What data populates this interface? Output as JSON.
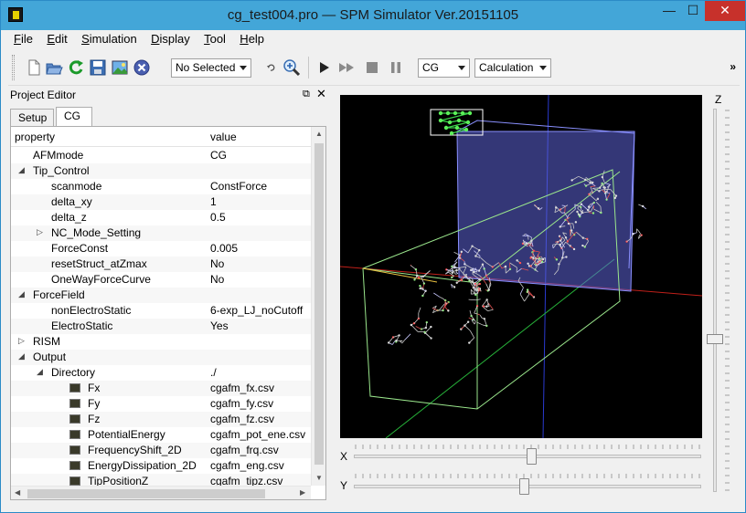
{
  "window": {
    "title": "cg_test004.pro — SPM Simulator Ver.20151105",
    "minimize": "—",
    "maximize": "☐",
    "close": "✕"
  },
  "menu": {
    "items": [
      {
        "key": "F",
        "rest": "ile"
      },
      {
        "key": "E",
        "rest": "dit"
      },
      {
        "key": "S",
        "rest": "imulation"
      },
      {
        "key": "D",
        "rest": "isplay"
      },
      {
        "key": "T",
        "rest": "ool"
      },
      {
        "key": "H",
        "rest": "elp"
      }
    ]
  },
  "toolbar": {
    "selection_combo": "No Selected",
    "mode_combo": "CG",
    "calc_combo": "Calculation",
    "more": "»",
    "icons": [
      "new-file-icon",
      "open-folder-icon",
      "reload-icon",
      "save-icon",
      "image-icon",
      "stop-circle-icon",
      "rotate-icon",
      "zoom-icon",
      "play-icon",
      "fast-forward-icon",
      "stop-icon",
      "pause-icon"
    ]
  },
  "project_editor": {
    "title": "Project Editor",
    "float_icon": "⧉",
    "close_icon": "✕",
    "tabs": [
      {
        "label": "Setup"
      },
      {
        "label": "CG"
      }
    ],
    "columns": {
      "property": "property",
      "value": "value"
    },
    "rows": [
      {
        "indent": 0,
        "expander": "",
        "file": false,
        "property": "AFMmode",
        "value": "CG"
      },
      {
        "indent": 0,
        "expander": "◢",
        "file": false,
        "property": "Tip_Control",
        "value": ""
      },
      {
        "indent": 1,
        "expander": "",
        "file": false,
        "property": "scanmode",
        "value": "ConstForce"
      },
      {
        "indent": 1,
        "expander": "",
        "file": false,
        "property": "delta_xy",
        "value": "1"
      },
      {
        "indent": 1,
        "expander": "",
        "file": false,
        "property": "delta_z",
        "value": "0.5"
      },
      {
        "indent": 1,
        "expander": "▷",
        "file": false,
        "property": "NC_Mode_Setting",
        "value": ""
      },
      {
        "indent": 1,
        "expander": "",
        "file": false,
        "property": "ForceConst",
        "value": "0.005"
      },
      {
        "indent": 1,
        "expander": "",
        "file": false,
        "property": "resetStruct_atZmax",
        "value": "No"
      },
      {
        "indent": 1,
        "expander": "",
        "file": false,
        "property": "OneWayForceCurve",
        "value": "No"
      },
      {
        "indent": 0,
        "expander": "◢",
        "file": false,
        "property": "ForceField",
        "value": ""
      },
      {
        "indent": 1,
        "expander": "",
        "file": false,
        "property": "nonElectroStatic",
        "value": "6-exp_LJ_noCutoff"
      },
      {
        "indent": 1,
        "expander": "",
        "file": false,
        "property": "ElectroStatic",
        "value": "Yes"
      },
      {
        "indent": 0,
        "expander": "▷",
        "file": false,
        "property": "RISM",
        "value": ""
      },
      {
        "indent": 0,
        "expander": "◢",
        "file": false,
        "property": "Output",
        "value": ""
      },
      {
        "indent": 1,
        "expander": "◢",
        "file": false,
        "property": "Directory",
        "value": "./"
      },
      {
        "indent": 2,
        "expander": "",
        "file": true,
        "property": "Fx",
        "value": "cgafm_fx.csv"
      },
      {
        "indent": 2,
        "expander": "",
        "file": true,
        "property": "Fy",
        "value": "cgafm_fy.csv"
      },
      {
        "indent": 2,
        "expander": "",
        "file": true,
        "property": "Fz",
        "value": "cgafm_fz.csv"
      },
      {
        "indent": 2,
        "expander": "",
        "file": true,
        "property": "PotentialEnergy",
        "value": "cgafm_pot_ene.csv"
      },
      {
        "indent": 2,
        "expander": "",
        "file": true,
        "property": "FrequencyShift_2D",
        "value": "cgafm_frq.csv"
      },
      {
        "indent": 2,
        "expander": "",
        "file": true,
        "property": "EnergyDissipation_2D",
        "value": "cgafm_eng.csv"
      },
      {
        "indent": 2,
        "expander": "",
        "file": true,
        "property": "TipPositionZ",
        "value": "cgafm_tipz.csv"
      }
    ]
  },
  "viewer": {
    "z_label": "Z",
    "x_label": "X",
    "y_label": "Y",
    "x_slider_fraction": 0.51,
    "y_slider_fraction": 0.49,
    "z_slider_fraction": 0.6
  }
}
